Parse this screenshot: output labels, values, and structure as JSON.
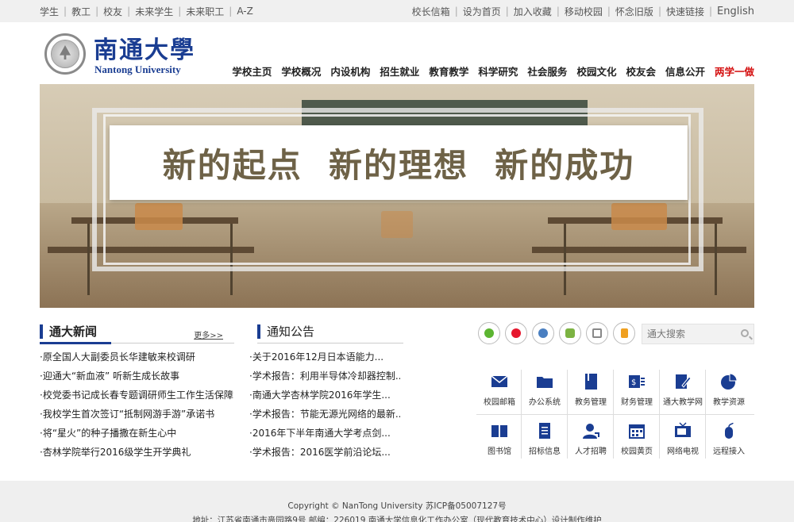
{
  "topbar": {
    "left": [
      "学生",
      "教工",
      "校友",
      "未来学生",
      "未来职工",
      "A-Z"
    ],
    "right": [
      "校长信箱",
      "设为首页",
      "加入收藏",
      "移动校园",
      "怀念旧版",
      "快速链接",
      "English"
    ]
  },
  "header": {
    "logo_cn": "南通大學",
    "logo_en": "Nantong University",
    "nav": [
      "学校主页",
      "学校概况",
      "内设机构",
      "招生就业",
      "教育教学",
      "科学研究",
      "社会服务",
      "校园文化",
      "校友会",
      "信息公开",
      "两学一做"
    ]
  },
  "banner": {
    "slogan": "新的起点  新的理想  新的成功"
  },
  "news": {
    "title": "通大新闻",
    "more": "更多>>",
    "items": [
      "·原全国人大副委员长华建敏来校调研",
      "·迎通大“新血液” 听新生成长故事",
      "·校党委书记成长春专题调研师生工作生活保障",
      "·我校学生首次签订“抵制网游手游”承诺书",
      "·将“星火”的种子播撒在新生心中",
      "·杏林学院举行2016级学生开学典礼"
    ]
  },
  "notices": {
    "title": "通知公告",
    "items": [
      "·关于2016年12月日本语能力...",
      "·学术报告：利用半导体冷却器控制...",
      "·南通大学杏林学院2016年学生...",
      "·学术报告：节能无源光网络的最新...",
      "·2016年下半年南通大学考点剑...",
      "·学术报告：2016医学前沿论坛..."
    ]
  },
  "social": {
    "icons": [
      {
        "name": "wechat-icon",
        "color": "#5cb531"
      },
      {
        "name": "weibo-icon",
        "color": "#e6162d"
      },
      {
        "name": "apple-icon",
        "color": "#4a7fc1"
      },
      {
        "name": "android-icon",
        "color": "#7cb342"
      },
      {
        "name": "tablet-icon",
        "color": "#888888"
      },
      {
        "name": "mobile-app-icon",
        "color": "#f0a020"
      }
    ]
  },
  "search": {
    "placeholder": "通大搜索"
  },
  "services": {
    "row1": [
      "校园邮箱",
      "办公系统",
      "教务管理",
      "财务管理",
      "通大教学网",
      "教学资源"
    ],
    "row2": [
      "图书馆",
      "招标信息",
      "人才招聘",
      "校园黄页",
      "网络电视",
      "远程接入"
    ]
  },
  "footer": {
    "line1": "Copyright © NanTong University 苏ICP备05007127号",
    "line2": "地址：江苏省南通市啬园路9号 邮编：226019 南通大学信息化工作办公室（现代教育技术中心）设计制作维护"
  },
  "colors": {
    "brand": "#1a3d92",
    "highlight": "#d40f0f",
    "icon_blue": "#1a3d92"
  }
}
